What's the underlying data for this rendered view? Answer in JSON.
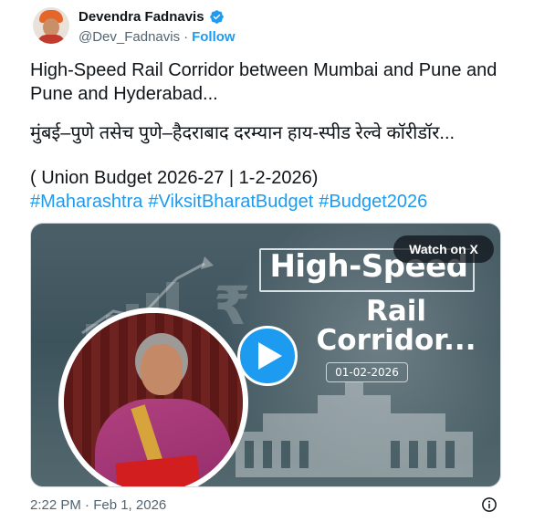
{
  "author": {
    "name": "Devendra Fadnavis",
    "handle": "@Dev_Fadnavis",
    "separator": "·",
    "follow_label": "Follow",
    "verified_color": "#1d9bf0"
  },
  "post": {
    "line1": "High-Speed Rail Corridor between Mumbai and Pune and Pune and Hyderabad...",
    "line2": "मुंबई–पुणे तसेच पुणे–हैदराबाद दरम्यान हाय-स्पीड रेल्वे कॉरीडॉर...",
    "line3": "( Union Budget 2026-27 | 1-2-2026)",
    "hashtags": [
      "#Maharashtra",
      "#ViksitBharatBudget",
      "#Budget2026"
    ],
    "link_color": "#1d9bf0"
  },
  "media": {
    "title_line1": "High-Speed",
    "title_line2": "Rail",
    "title_line3": "Corridor...",
    "date": "01-02-2026",
    "watch_label": "Watch on X",
    "play_icon": "play-icon"
  },
  "footer": {
    "timestamp": "2:22 PM · Feb 1, 2026",
    "info_icon": "info-icon"
  }
}
